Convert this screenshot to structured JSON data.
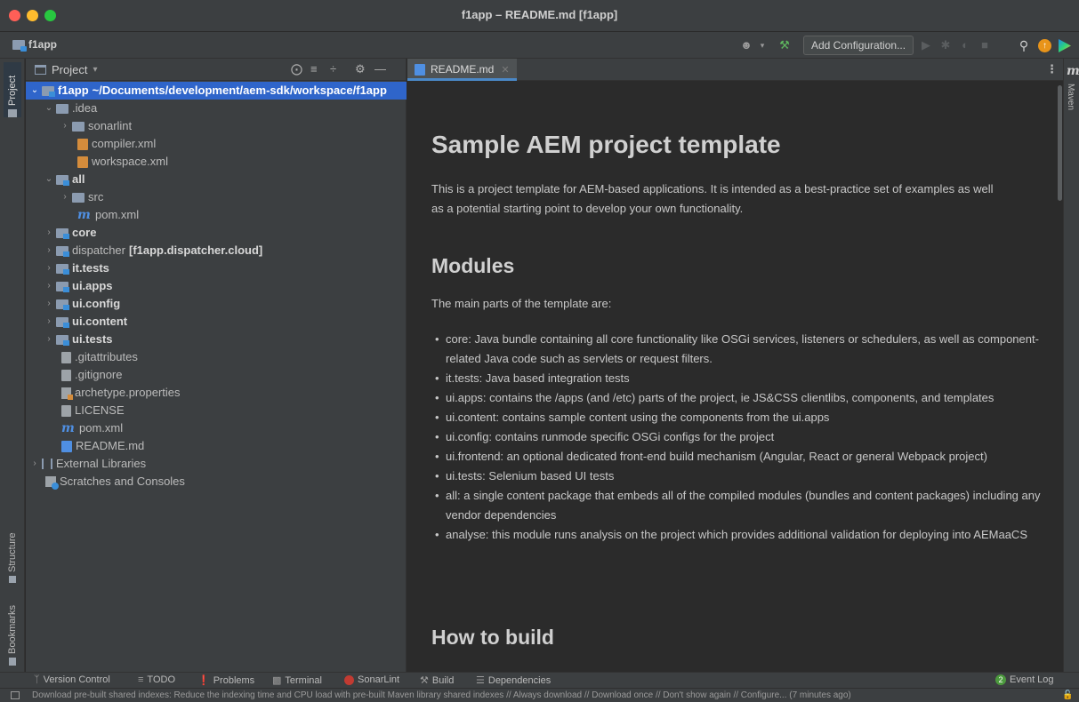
{
  "window": {
    "title": "f1app – README.md [f1app]"
  },
  "nav": {
    "project_name": "f1app",
    "add_config_label": "Add Configuration..."
  },
  "left_strip": {
    "project_tab": "Project",
    "structure_tab": "Structure",
    "bookmarks_tab": "Bookmarks"
  },
  "right_strip": {
    "maven_tab": "Maven",
    "maven_glyph": "m"
  },
  "project_panel": {
    "view_label": "Project",
    "dropdown_glyph": "▾",
    "tree": {
      "root_name": "f1app",
      "root_path": "~/Documents/development/aem-sdk/workspace/f1app",
      "idea": ".idea",
      "sonarlint": "sonarlint",
      "compiler_xml": "compiler.xml",
      "workspace_xml": "workspace.xml",
      "all": "all",
      "src": "src",
      "all_pom": "pom.xml",
      "core": "core",
      "dispatcher": "dispatcher",
      "dispatcher_module": "[f1app.dispatcher.cloud]",
      "it_tests": "it.tests",
      "ui_apps": "ui.apps",
      "ui_config": "ui.config",
      "ui_content": "ui.content",
      "ui_tests": "ui.tests",
      "gitattributes": ".gitattributes",
      "gitignore": ".gitignore",
      "archetype": "archetype.properties",
      "license": "LICENSE",
      "root_pom": "pom.xml",
      "readme": "README.md",
      "external_libraries": "External Libraries",
      "scratches": "Scratches and Consoles"
    }
  },
  "editor": {
    "tab_label": "README.md",
    "h1": "Sample AEM project template",
    "intro_line1": "This is a project template for AEM-based applications. It is intended as a best-practice set of examples as well",
    "intro_line2": "as a potential starting point to develop your own functionality.",
    "modules_heading": "Modules",
    "modules_intro": "The main parts of the template are:",
    "bullets": [
      "core: Java bundle containing all core functionality like OSGi services, listeners or schedulers, as well as component-related Java code such as servlets or request filters.",
      "it.tests: Java based integration tests",
      "ui.apps: contains the /apps (and /etc) parts of the project, ie JS&CSS clientlibs, components, and templates",
      "ui.content: contains sample content using the components from the ui.apps",
      "ui.config: contains runmode specific OSGi configs for the project",
      "ui.frontend: an optional dedicated front-end build mechanism (Angular, React or general Webpack project)",
      "ui.tests: Selenium based UI tests",
      "all: a single content package that embeds all of the compiled modules (bundles and content packages) including any vendor dependencies",
      "analyse: this module runs analysis on the project which provides additional validation for deploying into AEMaaCS"
    ],
    "build_heading": "How to build"
  },
  "bottom_bar": {
    "version_control": "Version Control",
    "todo": "TODO",
    "problems": "Problems",
    "terminal": "Terminal",
    "sonarlint": "SonarLint",
    "build": "Build",
    "dependencies": "Dependencies",
    "event_log": "Event Log",
    "event_count": "2"
  },
  "status_bar": {
    "message": "Download pre-built shared indexes: Reduce the indexing time and CPU load with pre-built Maven library shared indexes // Always download // Download once // Don't show again // Configure... (7 minutes ago)"
  },
  "colors": {
    "background": "#2b2b2b",
    "panel": "#3c3f41",
    "selection": "#2f65ca",
    "accent_tab": "#4a88c7"
  }
}
